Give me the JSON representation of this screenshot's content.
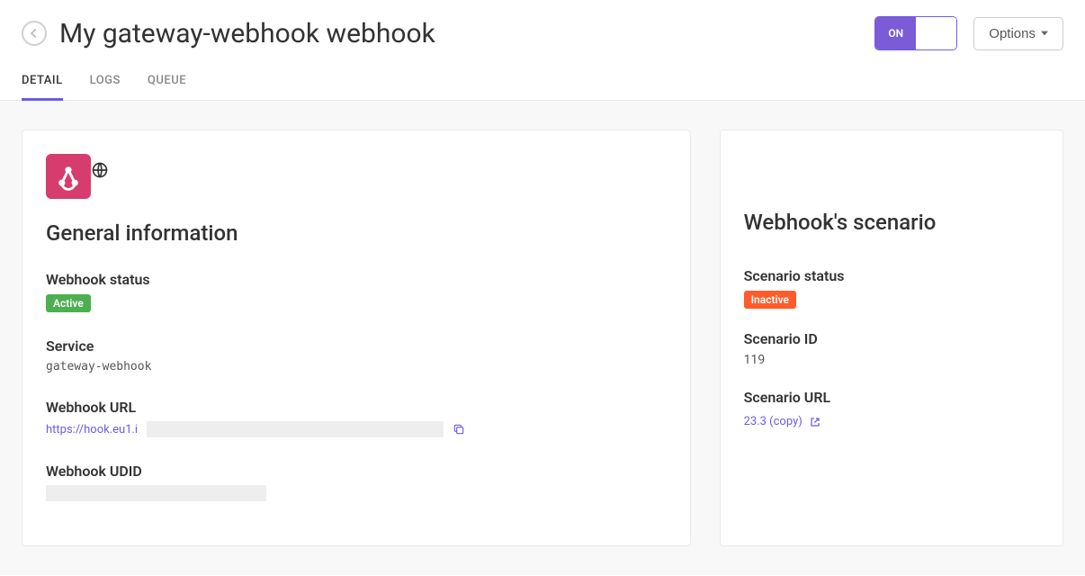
{
  "header": {
    "title": "My gateway-webhook webhook",
    "toggle_on_label": "ON",
    "options_label": "Options"
  },
  "tabs": [
    {
      "label": "DETAIL",
      "active": true
    },
    {
      "label": "LOGS",
      "active": false
    },
    {
      "label": "QUEUE",
      "active": false
    }
  ],
  "general": {
    "section_title": "General information",
    "status_label": "Webhook status",
    "status_value": "Active",
    "service_label": "Service",
    "service_value": "gateway-webhook",
    "url_label": "Webhook URL",
    "url_prefix": "https://hook.eu1.i",
    "udid_label": "Webhook UDID"
  },
  "scenario": {
    "section_title": "Webhook's scenario",
    "status_label": "Scenario status",
    "status_value": "Inactive",
    "id_label": "Scenario ID",
    "id_value": "119",
    "url_label": "Scenario URL",
    "url_value": "23.3 (copy)"
  }
}
